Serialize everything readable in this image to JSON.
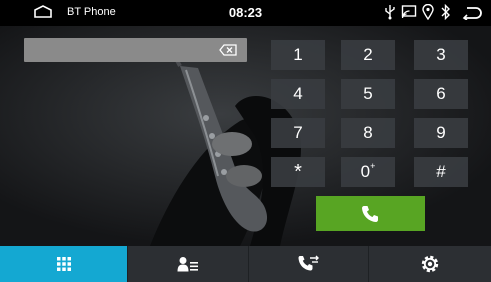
{
  "status_bar": {
    "app_title": "BT Phone",
    "time": "08:23",
    "icons": [
      "usb-icon",
      "screen-mirror-icon",
      "location-icon",
      "bluetooth-icon",
      "back-icon"
    ]
  },
  "dialer": {
    "number_value": "",
    "keys": [
      "1",
      "2",
      "3",
      "4",
      "5",
      "6",
      "7",
      "8",
      "9",
      "*",
      "0",
      "#"
    ],
    "zero_superscript": "+"
  },
  "bottom_nav": {
    "tabs": [
      "keypad-icon",
      "contacts-icon",
      "call-log-icon",
      "settings-icon"
    ],
    "active_tab": 0
  },
  "colors": {
    "status_bg": "#000000",
    "input_bg": "#8a8a8a",
    "key_bg": "#383c40",
    "call_green": "#58a523",
    "active_tab": "#14a8d2",
    "nav_bg": "#2c2f33"
  }
}
